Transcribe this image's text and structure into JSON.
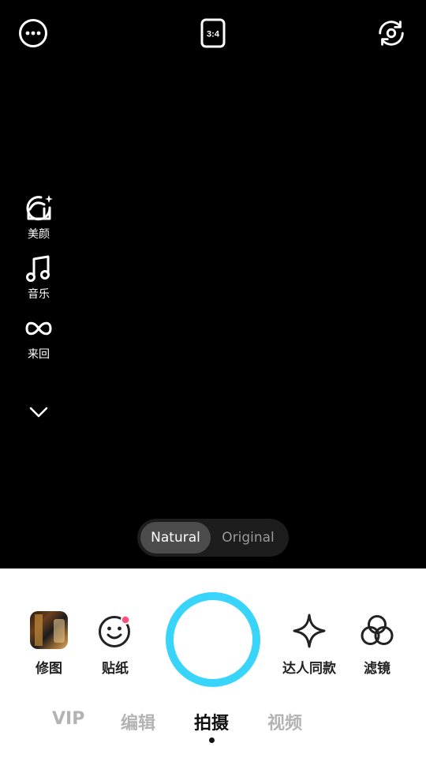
{
  "top_bar": {
    "more_icon": "more-dots-icon",
    "ratio_label": "3:4",
    "flip_icon": "switch-camera-icon"
  },
  "side_tools": {
    "items": [
      {
        "label": "美颜",
        "icon": "beauty-face-icon"
      },
      {
        "label": "音乐",
        "icon": "music-note-icon"
      },
      {
        "label": "来回",
        "icon": "boomerang-icon"
      }
    ],
    "expand_icon": "chevron-down-icon"
  },
  "mode_toggle": {
    "options": [
      "Natural",
      "Original"
    ],
    "selected": "Natural"
  },
  "bottom_tools": {
    "left": [
      {
        "label": "修图",
        "icon": "photo-thumbnail"
      },
      {
        "label": "贴纸",
        "icon": "sticker-smile-icon",
        "badge_color": "#ff4f7b"
      }
    ],
    "right": [
      {
        "label": "达人同款",
        "icon": "sparkle-star-icon"
      },
      {
        "label": "滤镜",
        "icon": "filter-circles-icon"
      }
    ]
  },
  "shutter": {
    "ring_color": "#39d4fa"
  },
  "tabs": {
    "items": [
      "VIP",
      "编辑",
      "拍摄",
      "视频"
    ],
    "selected": "拍摄"
  }
}
